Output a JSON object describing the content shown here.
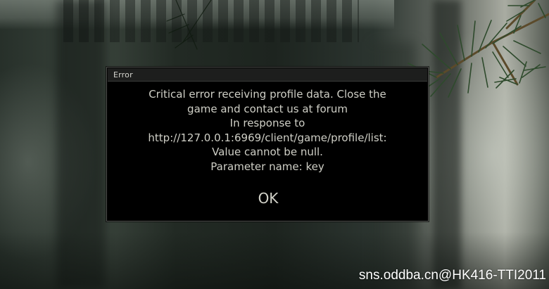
{
  "dialog": {
    "title": "Error",
    "message_lines": [
      "Critical error receiving profile data. Close the",
      "game and contact us at forum",
      "In response to",
      "http://127.0.0.1:6969/client/game/profile/list:",
      "Value cannot be null.",
      "Parameter name: key"
    ],
    "ok_label": "OK"
  },
  "watermark": {
    "text": "sns.oddba.cn@HK416-TTI2011"
  },
  "colors": {
    "dialog_background": "#000000",
    "dialog_border": "#4e4f4c",
    "titlebar_background": "#1d1e1d",
    "text": "#cfcfc6"
  }
}
